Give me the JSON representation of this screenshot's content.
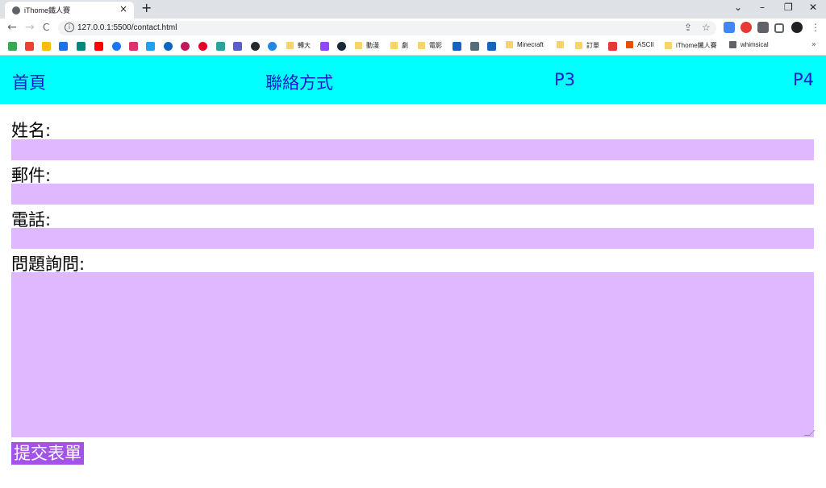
{
  "browser": {
    "tab_title": "iThome鐵人賽",
    "tab_close": "×",
    "new_tab": "+",
    "url": "127.0.0.1:5500/contact.html",
    "window_controls": [
      "⌄",
      "–",
      "❐",
      "✕"
    ],
    "nav_buttons": [
      "←",
      "→",
      "C"
    ]
  },
  "bookmarks": [
    {
      "label": "轉大"
    },
    {
      "label": "動漫"
    },
    {
      "label": "劇"
    },
    {
      "label": "電影"
    },
    {
      "label": "Minecraft"
    },
    {
      "label": "訂單"
    },
    {
      "label": "ASCII"
    },
    {
      "label": "iThome鐵人賽"
    },
    {
      "label": "whimsical"
    }
  ],
  "bookmarks_more": "»",
  "nav": {
    "items": [
      {
        "label": "首頁"
      },
      {
        "label": "聯絡方式"
      },
      {
        "label": "P3"
      },
      {
        "label": "P4"
      }
    ]
  },
  "form": {
    "name_label": "姓名:",
    "email_label": "郵件:",
    "phone_label": "電話:",
    "question_label": "問題詢問:",
    "name_value": "",
    "email_value": "",
    "phone_value": "",
    "question_value": "",
    "submit_label": "提交表單"
  },
  "colors": {
    "nav_bg": "#00ffff",
    "nav_link": "#1a1acd",
    "field_bg": "#e0b8ff",
    "submit_bg": "#a453e8"
  }
}
